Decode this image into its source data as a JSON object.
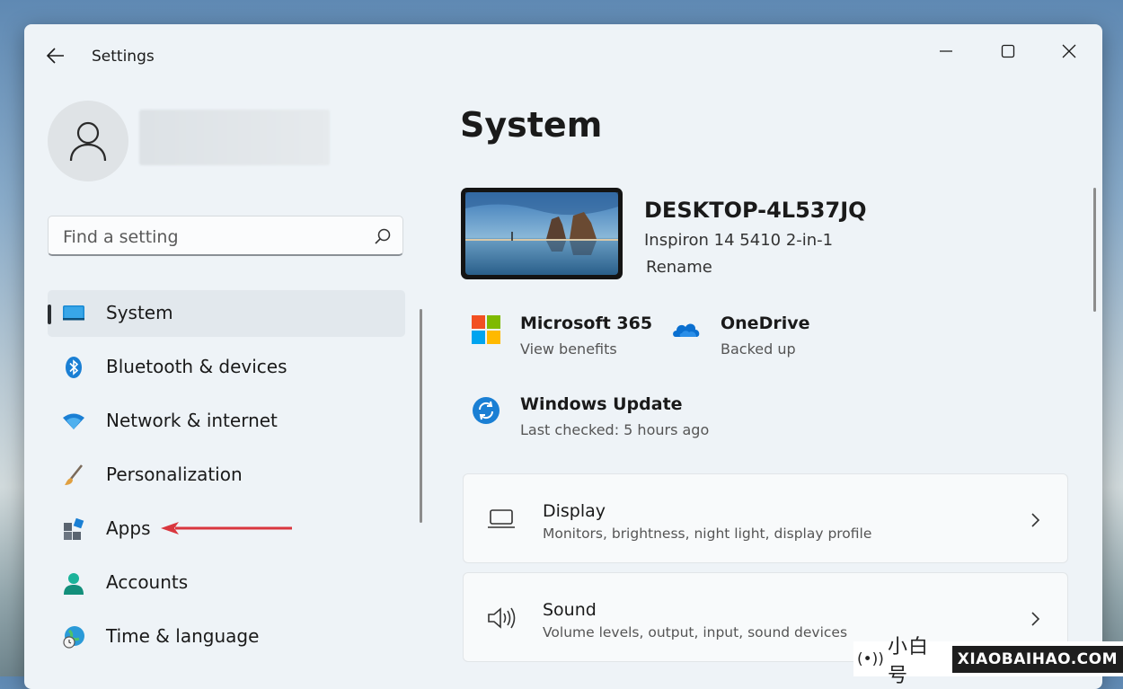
{
  "window": {
    "title": "Settings",
    "controls": [
      "minimize",
      "maximize",
      "close"
    ]
  },
  "user": {
    "avatar_icon": "person-icon"
  },
  "search": {
    "placeholder": "Find a setting",
    "icon": "search-icon"
  },
  "sidebar": {
    "items": [
      {
        "label": "System",
        "icon": "monitor-icon",
        "selected": true
      },
      {
        "label": "Bluetooth & devices",
        "icon": "bluetooth-icon"
      },
      {
        "label": "Network & internet",
        "icon": "wifi-icon"
      },
      {
        "label": "Personalization",
        "icon": "brush-icon"
      },
      {
        "label": "Apps",
        "icon": "apps-icon"
      },
      {
        "label": "Accounts",
        "icon": "person-icon"
      },
      {
        "label": "Time & language",
        "icon": "globe-clock-icon"
      }
    ]
  },
  "main": {
    "title": "System",
    "device": {
      "name": "DESKTOP-4L537JQ",
      "model": "Inspiron 14 5410 2-in-1",
      "rename": "Rename"
    },
    "tiles": [
      {
        "title": "Microsoft 365",
        "subtitle": "View benefits",
        "icon": "microsoft-logo-icon"
      },
      {
        "title": "OneDrive",
        "subtitle": "Backed up",
        "icon": "cloud-icon"
      },
      {
        "title": "Windows Update",
        "subtitle": "Last checked: 5 hours ago",
        "icon": "sync-icon"
      }
    ],
    "cards": [
      {
        "title": "Display",
        "subtitle": "Monitors, brightness, night light, display profile",
        "icon": "laptop-icon"
      },
      {
        "title": "Sound",
        "subtitle": "Volume levels, output, input, sound devices",
        "icon": "speaker-icon"
      }
    ]
  },
  "watermark": {
    "symbol": "(•))",
    "cn": "小白号",
    "en": "XIAOBAIHAO.COM"
  },
  "colors": {
    "accent": "#0078d4",
    "arrow": "#d9363e",
    "window_bg": "#eef3f7"
  }
}
